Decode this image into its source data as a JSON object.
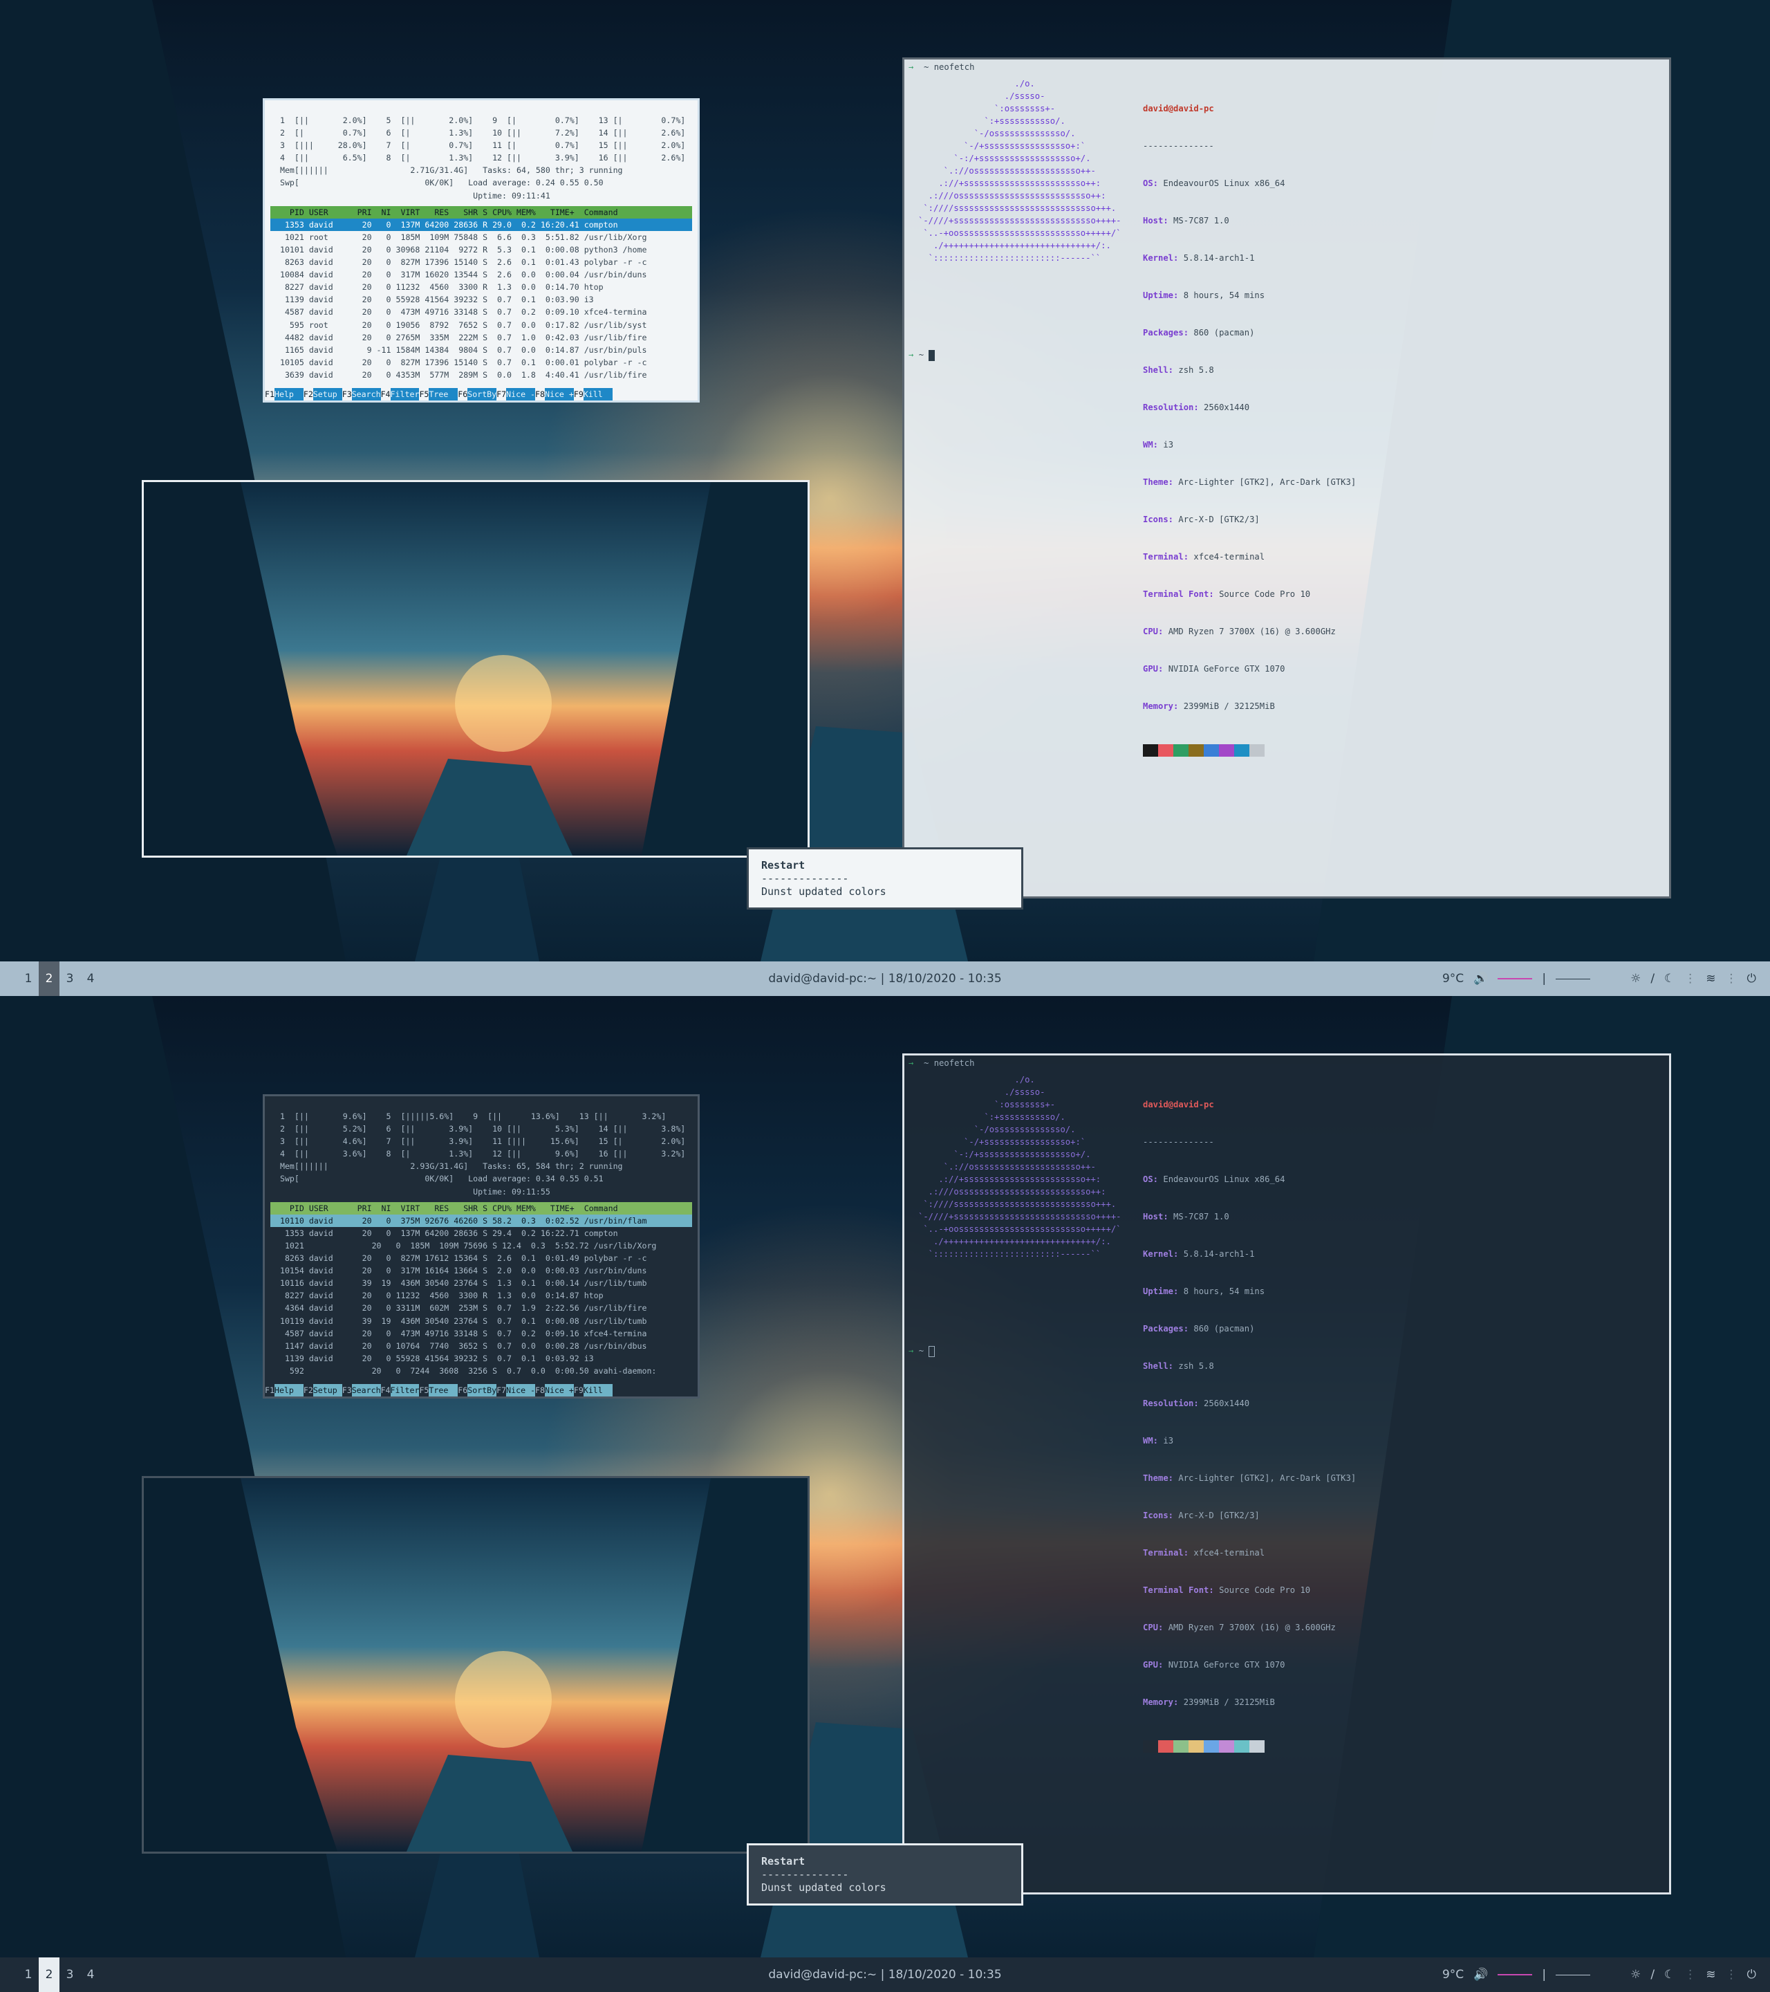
{
  "bar": {
    "workspaces": [
      "1",
      "2",
      "3",
      "4"
    ],
    "active_workspace_top": "2",
    "active_workspace_bottom": "2",
    "title": "david@david-pc:~",
    "separator": "|",
    "datetime": "18/10/2020 - 10:35",
    "temp": "9°C",
    "icons": [
      "volume-icon",
      "brightness-icon",
      "night-mode-icon",
      "wifi-icon",
      "power-icon"
    ]
  },
  "neofetch": {
    "command": "neofetch",
    "prompt": "→",
    "tilde": "~",
    "user_host": "david@david-pc",
    "rule": "--------------",
    "os_k": "OS:",
    "os_v": " EndeavourOS Linux x86_64",
    "host_k": "Host:",
    "host_v": " MS-7C87 1.0",
    "kernel_k": "Kernel:",
    "kernel_v": " 5.8.14-arch1-1",
    "uptime_k": "Uptime:",
    "uptime_v": " 8 hours, 54 mins",
    "pkg_k": "Packages:",
    "pkg_v": " 860 (pacman)",
    "shell_k": "Shell:",
    "shell_v": " zsh 5.8",
    "res_k": "Resolution:",
    "res_v": " 2560x1440",
    "wm_k": "WM:",
    "wm_v": " i3",
    "theme_k": "Theme:",
    "theme_v": " Arc-Lighter [GTK2], Arc-Dark [GTK3]",
    "icons_k": "Icons:",
    "icons_v": " Arc-X-D [GTK2/3]",
    "term_k": "Terminal:",
    "term_v": " xfce4-terminal",
    "tfont_k": "Terminal Font:",
    "tfont_v": " Source Code Pro 10",
    "cpu_k": "CPU:",
    "cpu_v": " AMD Ryzen 7 3700X (16) @ 3.600GHz",
    "gpu_k": "GPU:",
    "gpu_v": " NVIDIA GeForce GTX 1070",
    "mem_k": "Memory:",
    "mem_v": " 2399MiB / 32125MiB",
    "logo": "                   ./o.\n                 ./sssso-\n               `:osssssss+-\n             `:+sssssssssso/.\n           `-/ossssssssssssso/.\n         `-/+sssssssssssssssso+:`\n       `-:/+sssssssssssssssssso+/.\n     `.://osssssssssssssssssssso++-\n    .://+ssssssssssssssssssssssso++:\n  .:///ossssssssssssssssssssssssso++:\n `:////ssssssssssssssssssssssssssso+++.\n`-////+ssssssssssssssssssssssssssso++++-\n `..-+oosssssssssssssssssssssssso+++++/`\n   ./++++++++++++++++++++++++++++++/:.\n  `:::::::::::::::::::::::::------``",
    "palette_light": [
      "#1a1a1a",
      "#e8575f",
      "#2f9e63",
      "#8a6d1e",
      "#3a7fd6",
      "#a347c8",
      "#1e8fc4",
      "#c0c6cc"
    ],
    "palette_dark": [
      "#202b36",
      "#e05a5a",
      "#8cc08a",
      "#e4c27a",
      "#6aa6e6",
      "#c28ad6",
      "#6ac1c7",
      "#c7d0d8"
    ]
  },
  "htop_top": {
    "cpus": [
      "  1  [||       2.0%]    5  [||       2.0%]    9  [|        0.7%]    13 [|        0.7%]",
      "  2  [|        0.7%]    6  [|        1.3%]    10 [||       7.2%]    14 [||       2.6%]",
      "  3  [|||     28.0%]    7  [|        0.7%]    11 [|        0.7%]    15 [||       2.0%]",
      "  4  [||       6.5%]    8  [|        1.3%]    12 [||       3.9%]    16 [||       2.6%]"
    ],
    "mem": "  Mem[||||||                 2.71G/31.4G]   Tasks: 64, 580 thr; 3 running",
    "swp": "  Swp[                          0K/0K]   Load average: 0.24 0.55 0.50",
    "uptime": "                                          Uptime: 09:11:41",
    "header": "    PID USER      PRI  NI  VIRT   RES   SHR S CPU% MEM%   TIME+  Command",
    "rows": [
      "   1353 david      20   0  137M 64200 28636 R 29.0  0.2 16:20.41 compton",
      "   1021 root       20   0  185M  109M 75848 S  6.6  0.3  5:51.82 /usr/lib/Xorg",
      "  10101 david      20   0 30968 21104  9272 R  5.3  0.1  0:00.08 python3 /home",
      "   8263 david      20   0  827M 17396 15140 S  2.6  0.1  0:01.43 polybar -r -c",
      "  10084 david      20   0  317M 16020 13544 S  2.6  0.0  0:00.04 /usr/bin/duns",
      "   8227 david      20   0 11232  4560  3300 R  1.3  0.0  0:14.70 htop",
      "   1139 david      20   0 55928 41564 39232 S  0.7  0.1  0:03.90 i3",
      "   4587 david      20   0  473M 49716 33148 S  0.7  0.2  0:09.10 xfce4-termina",
      "    595 root       20   0 19056  8792  7652 S  0.7  0.0  0:17.82 /usr/lib/syst",
      "   4482 david      20   0 2765M  335M  222M S  0.7  1.0  0:42.03 /usr/lib/fire",
      "   1165 david       9 -11 1584M 14384  9804 S  0.7  0.0  0:14.87 /usr/bin/puls",
      "  10105 david      20   0  827M 17396 15140 S  0.7  0.1  0:00.01 polybar -r -c",
      "   3639 david      20   0 4353M  577M  289M S  0.0  1.8  4:40.41 /usr/lib/fire"
    ]
  },
  "htop_bottom": {
    "cpus": [
      "  1  [||       9.6%]    5  [|||||5.6%]    9  [||      13.6%]    13 [||       3.2%]",
      "  2  [||       5.2%]    6  [||       3.9%]    10 [||       5.3%]    14 [||       3.8%]",
      "  3  [||       4.6%]    7  [||       3.9%]    11 [|||     15.6%]    15 [|        2.0%]",
      "  4  [||       3.6%]    8  [|        1.3%]    12 [||       9.6%]    16 [||       3.2%]"
    ],
    "mem": "  Mem[||||||                 2.93G/31.4G]   Tasks: 65, 584 thr; 2 running",
    "swp": "  Swp[                          0K/0K]   Load average: 0.34 0.55 0.51",
    "uptime": "                                          Uptime: 09:11:55",
    "header": "    PID USER      PRI  NI  VIRT   RES   SHR S CPU% MEM%   TIME+  Command",
    "rows": [
      "  10110 david      20   0  375M 92676 46260 S 58.2  0.3  0:02.52 /usr/bin/flam",
      "   1353 david      20   0  137M 64200 28636 S 29.4  0.2 16:22.71 compton",
      "   1021              20   0  185M  109M 75696 S 12.4  0.3  5:52.72 /usr/lib/Xorg",
      "   8263 david      20   0  827M 17612 15364 S  2.6  0.1  0:01.49 polybar -r -c",
      "  10154 david      20   0  317M 16164 13664 S  2.0  0.0  0:00.03 /usr/bin/duns",
      "  10116 david      39  19  436M 30540 23764 S  1.3  0.1  0:00.14 /usr/lib/tumb",
      "   8227 david      20   0 11232  4560  3300 R  1.3  0.0  0:14.87 htop",
      "   4364 david      20   0 3311M  602M  253M S  0.7  1.9  2:22.56 /usr/lib/fire",
      "  10119 david      39  19  436M 30540 23764 S  0.7  0.1  0:00.08 /usr/lib/tumb",
      "   4587 david      20   0  473M 49716 33148 S  0.7  0.2  0:09.16 xfce4-termina",
      "   1147 david      20   0 10764  7740  3652 S  0.7  0.0  0:00.28 /usr/bin/dbus",
      "   1139 david      20   0 55928 41564 39232 S  0.7  0.1  0:03.92 i3",
      "    592              20   0  7244  3608  3256 S  0.7  0.0  0:00.50 avahi-daemon:"
    ]
  },
  "htop_footer": [
    {
      "k": "F1",
      "l": "Help  "
    },
    {
      "k": "F2",
      "l": "Setup "
    },
    {
      "k": "F3",
      "l": "Search"
    },
    {
      "k": "F4",
      "l": "Filter"
    },
    {
      "k": "F5",
      "l": "Tree  "
    },
    {
      "k": "F6",
      "l": "SortBy"
    },
    {
      "k": "F7",
      "l": "Nice -"
    },
    {
      "k": "F8",
      "l": "Nice +"
    },
    {
      "k": "F9",
      "l": "Kill  "
    }
  ],
  "dunst": {
    "title": "Restart",
    "rule": "--------------",
    "body": "Dunst updated colors"
  }
}
